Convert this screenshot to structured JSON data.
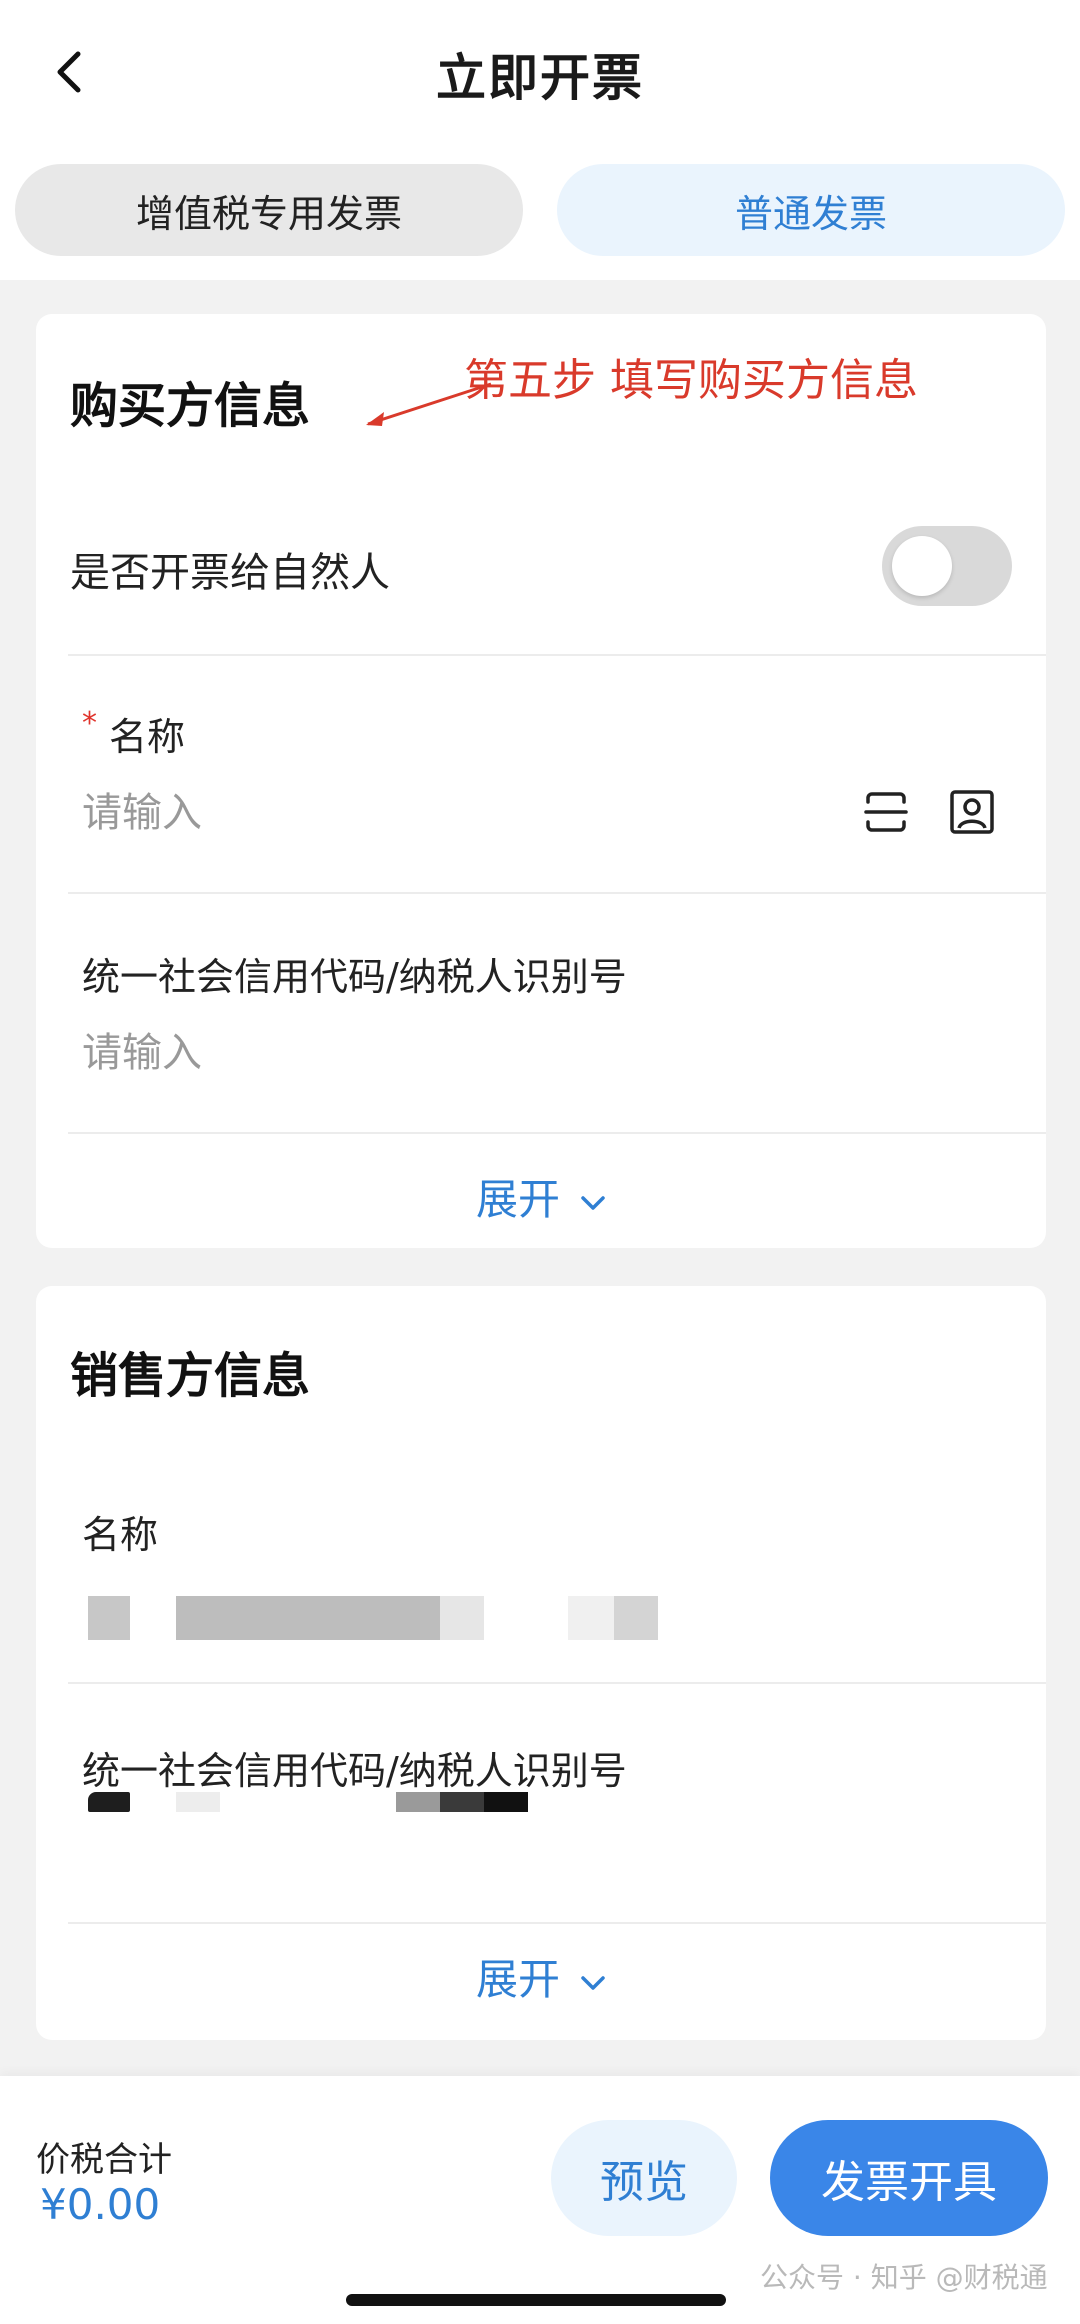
{
  "header": {
    "title": "立即开票"
  },
  "tabs": [
    {
      "label": "增值税专用发票",
      "selected": false
    },
    {
      "label": "普通发票",
      "selected": true
    }
  ],
  "buyer": {
    "title": "购买方信息",
    "annotation": "第五步 填写购买方信息",
    "natural_person_label": "是否开票给自然人",
    "natural_person_toggle": false,
    "name_label": "名称",
    "name_required_mark": "*",
    "name_placeholder": "请输入",
    "tax_id_label": "统一社会信用代码/纳税人识别号",
    "tax_id_placeholder": "请输入",
    "expand_label": "展开"
  },
  "seller": {
    "title": "销售方信息",
    "name_label": "名称",
    "tax_id_label": "统一社会信用代码/纳税人识别号",
    "expand_label": "展开"
  },
  "footer": {
    "total_label": "价税合计",
    "total_amount": "¥0.00",
    "preview_label": "预览",
    "issue_label": "发票开具",
    "watermark": "公众号 · 知乎 @财税通"
  },
  "colors": {
    "accent": "#3a86e8",
    "accent_light": "#eaf4fd",
    "annotation": "#d93a2b",
    "required": "#e0332b"
  }
}
